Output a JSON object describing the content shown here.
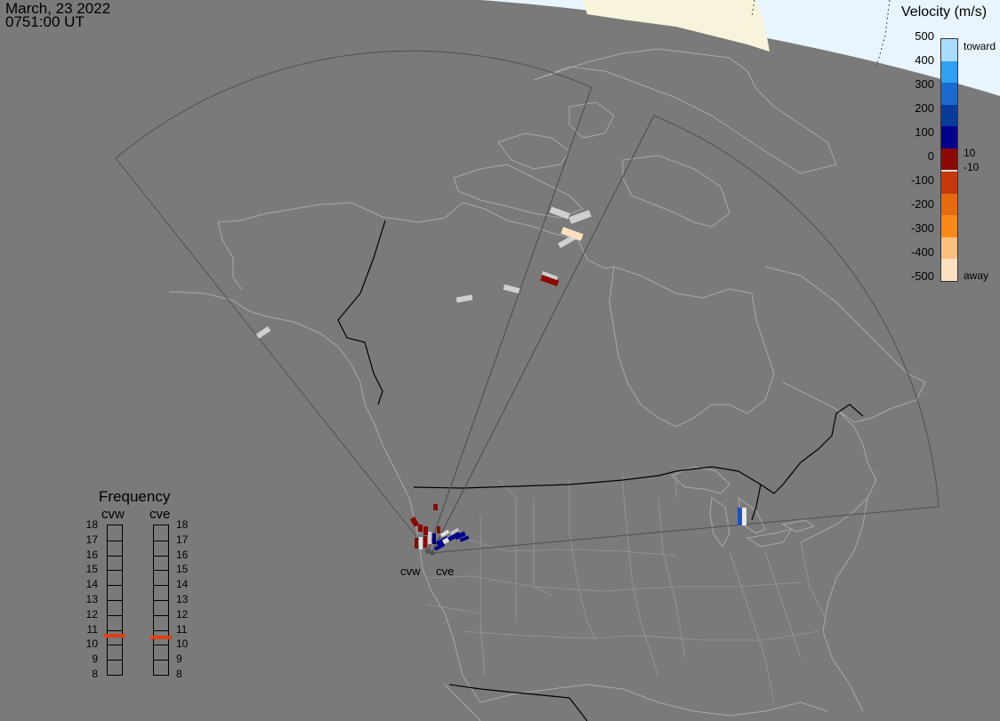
{
  "header": {
    "date": "March, 23 2022",
    "time": "0751:00 UT"
  },
  "colorbar": {
    "title": "Velocity (m/s)",
    "ticks": [
      "500",
      "400",
      "300",
      "200",
      "100",
      "0",
      "-100",
      "-200",
      "-300",
      "-400",
      "-500"
    ],
    "mid_labels": [
      "10",
      "-10"
    ],
    "toward_label": "toward",
    "away_label": "away",
    "colors": [
      "#fde0c0",
      "#fbbf80",
      "#f98a1a",
      "#e66a10",
      "#c43a0a",
      "#8a0a00",
      "#00008a",
      "#0a3a9a",
      "#1a6ad0",
      "#30a0f0",
      "#a8dcff"
    ]
  },
  "frequency_panel": {
    "title": "Frequency",
    "radars": [
      "cvw",
      "cve"
    ],
    "levels": [
      "18",
      "17",
      "16",
      "15",
      "14",
      "13",
      "12",
      "11",
      "10",
      "9",
      "8"
    ],
    "cvw_freq_mhz": 10.6,
    "cve_freq_mhz": 10.5,
    "marker_color": "#e04010"
  },
  "radars": [
    {
      "code": "cvw",
      "label": "cvw"
    },
    {
      "code": "cve",
      "label": "cve"
    }
  ],
  "map": {
    "background": "#7a7a7a",
    "daylight_color": "#e8f4ff",
    "land_sun_color": "#f8f4dc",
    "outline_color": "#a8a8a8",
    "border_color": "#000000",
    "fov_color": "#505050"
  }
}
